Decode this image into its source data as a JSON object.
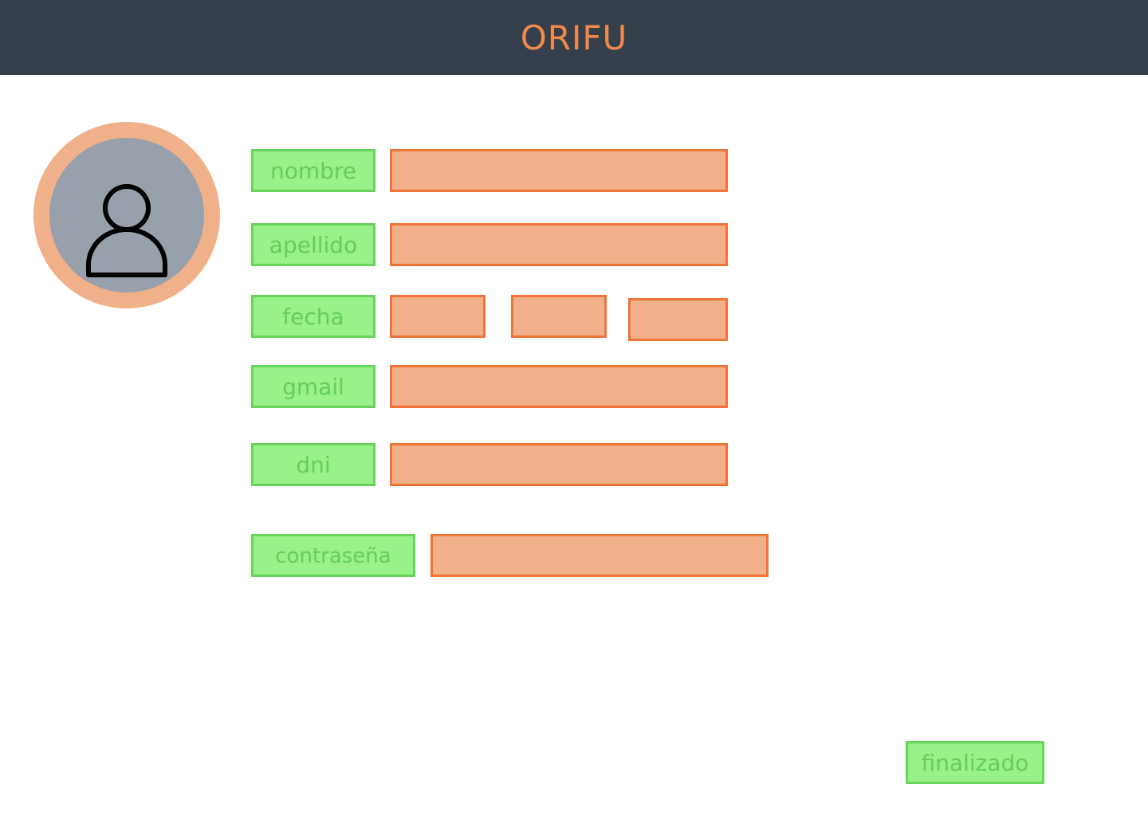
{
  "header": {
    "title": "ORIFU"
  },
  "avatar": {
    "icon": "user-icon"
  },
  "form": {
    "nombre_label": "nombre",
    "nombre_value": "",
    "apellido_label": "apellido",
    "apellido_value": "",
    "fecha_label": "fecha",
    "fecha_day_value": "",
    "fecha_month_value": "",
    "fecha_year_value": "",
    "gmail_label": "gmail",
    "gmail_value": "",
    "dni_label": "dni",
    "dni_value": "",
    "contrasena_label": "contraseña",
    "contrasena_value": ""
  },
  "actions": {
    "finish_label": "finalizado"
  },
  "colors": {
    "header_bg": "#363f4c",
    "accent_orange": "#f08a4b",
    "field_fill": "#f1b089",
    "field_border": "#ee7438",
    "label_fill": "#98f189",
    "label_border": "#67d55a",
    "avatar_ring": "#f0b089",
    "avatar_fill": "#98a0ab"
  }
}
